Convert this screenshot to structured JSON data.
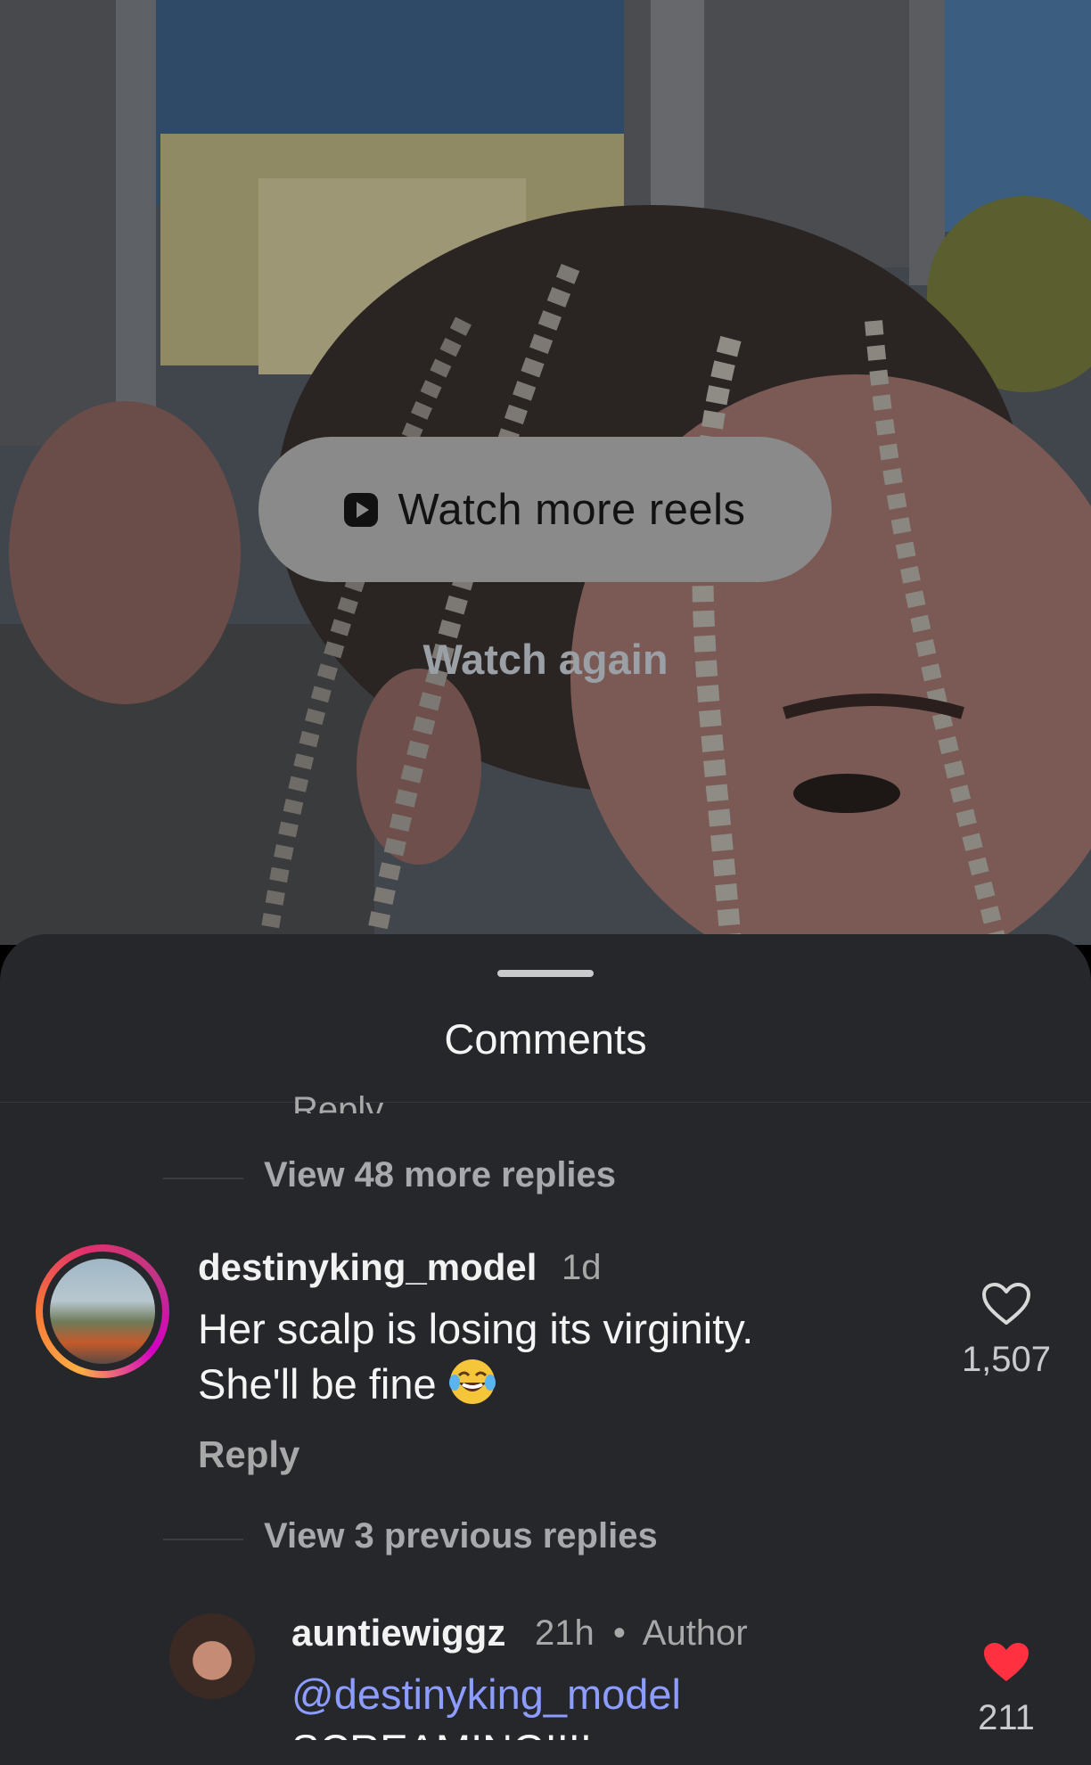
{
  "overlay": {
    "primary_button": "Watch more reels",
    "secondary_button": "Watch again"
  },
  "sheet": {
    "title": "Comments",
    "truncated_reply_label": "Reply",
    "view_more_replies": "View 48 more replies",
    "comment": {
      "username": "destinyking_model",
      "time": "1d",
      "text_line1": "Her scalp is losing its virginity.",
      "text_line2": "She'll be fine",
      "emoji": "face-with-tears-of-joy",
      "reply_label": "Reply",
      "likes": "1,507",
      "liked": false
    },
    "view_previous_replies": "View 3 previous replies",
    "reply": {
      "username": "auntiewiggz",
      "time": "21h",
      "separator": "•",
      "badge": "Author",
      "mention": "@destinyking_model",
      "text_cut": "SCREAMING!!!!",
      "likes": "211",
      "liked": true,
      "like_color": "#ff3040"
    }
  }
}
